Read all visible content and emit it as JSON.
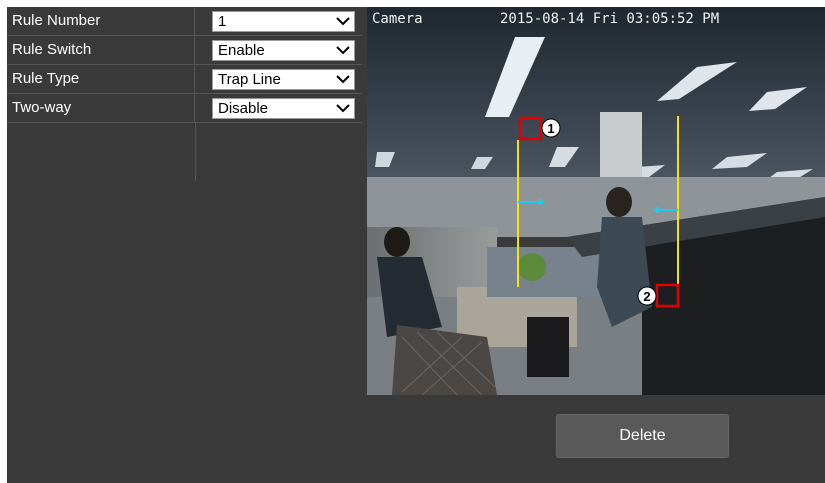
{
  "rules": [
    {
      "label": "Rule Number",
      "value": "1"
    },
    {
      "label": "Rule Switch",
      "value": "Enable"
    },
    {
      "label": "Rule Type",
      "value": "Trap Line"
    },
    {
      "label": "Two-way",
      "value": "Disable"
    }
  ],
  "video": {
    "camera_label": "Camera",
    "timestamp": "2015-08-14 Fri 03:05:52 PM",
    "marker_1": "1",
    "marker_2": "2"
  },
  "actions": {
    "delete_label": "Delete"
  },
  "colors": {
    "trap_line": "#f2e600",
    "marker_box": "#e00000",
    "direction_arrow": "#24c8e8"
  }
}
